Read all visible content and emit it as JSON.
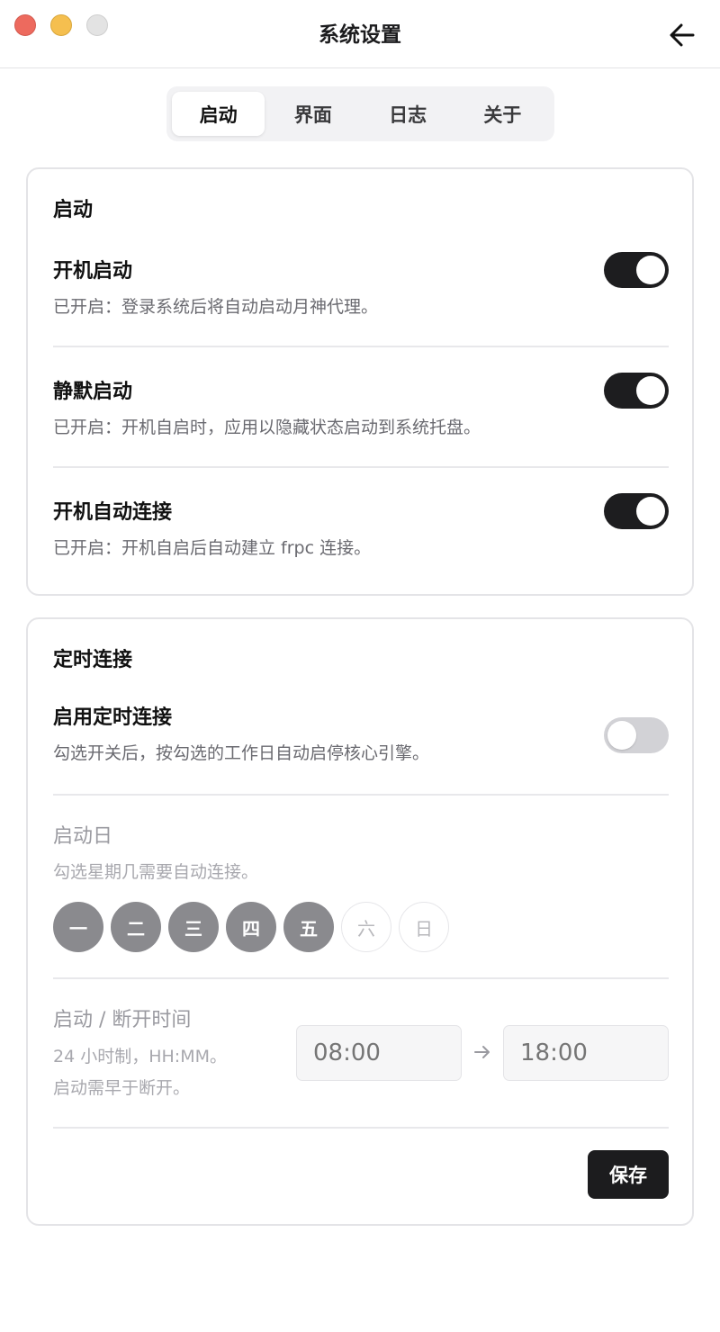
{
  "window": {
    "title": "系统设置"
  },
  "tabs": [
    {
      "label": "启动",
      "active": true
    },
    {
      "label": "界面",
      "active": false
    },
    {
      "label": "日志",
      "active": false
    },
    {
      "label": "关于",
      "active": false
    }
  ],
  "startup": {
    "title": "启动",
    "items": [
      {
        "title": "开机启动",
        "desc": "已开启：登录系统后将自动启动月神代理。",
        "on": true
      },
      {
        "title": "静默启动",
        "desc": "已开启：开机自启时，应用以隐藏状态启动到系统托盘。",
        "on": true
      },
      {
        "title": "开机自动连接",
        "desc": "已开启：开机自启后自动建立 frpc 连接。",
        "on": true
      }
    ]
  },
  "schedule": {
    "title": "定时连接",
    "enable": {
      "title": "启用定时连接",
      "desc": "勾选开关后，按勾选的工作日自动启停核心引擎。",
      "on": false
    },
    "days": {
      "title": "启动日",
      "desc": "勾选星期几需要自动连接。",
      "items": [
        {
          "label": "一",
          "selected": true
        },
        {
          "label": "二",
          "selected": true
        },
        {
          "label": "三",
          "selected": true
        },
        {
          "label": "四",
          "selected": true
        },
        {
          "label": "五",
          "selected": true
        },
        {
          "label": "六",
          "selected": false
        },
        {
          "label": "日",
          "selected": false
        }
      ]
    },
    "time": {
      "title": "启动 / 断开时间",
      "desc_line1": "24 小时制，HH:MM。",
      "desc_line2": "启动需早于断开。",
      "start_placeholder": "08:00",
      "end_placeholder": "18:00"
    },
    "save_label": "保存"
  },
  "colors": {
    "toggle_on": "#1d1d1f",
    "toggle_off": "#d2d2d6",
    "day_selected": "#8a8a8e",
    "close": "#ed6a5e",
    "minimize": "#f5bf4f",
    "zoom_disabled": "#e3e3e3"
  }
}
